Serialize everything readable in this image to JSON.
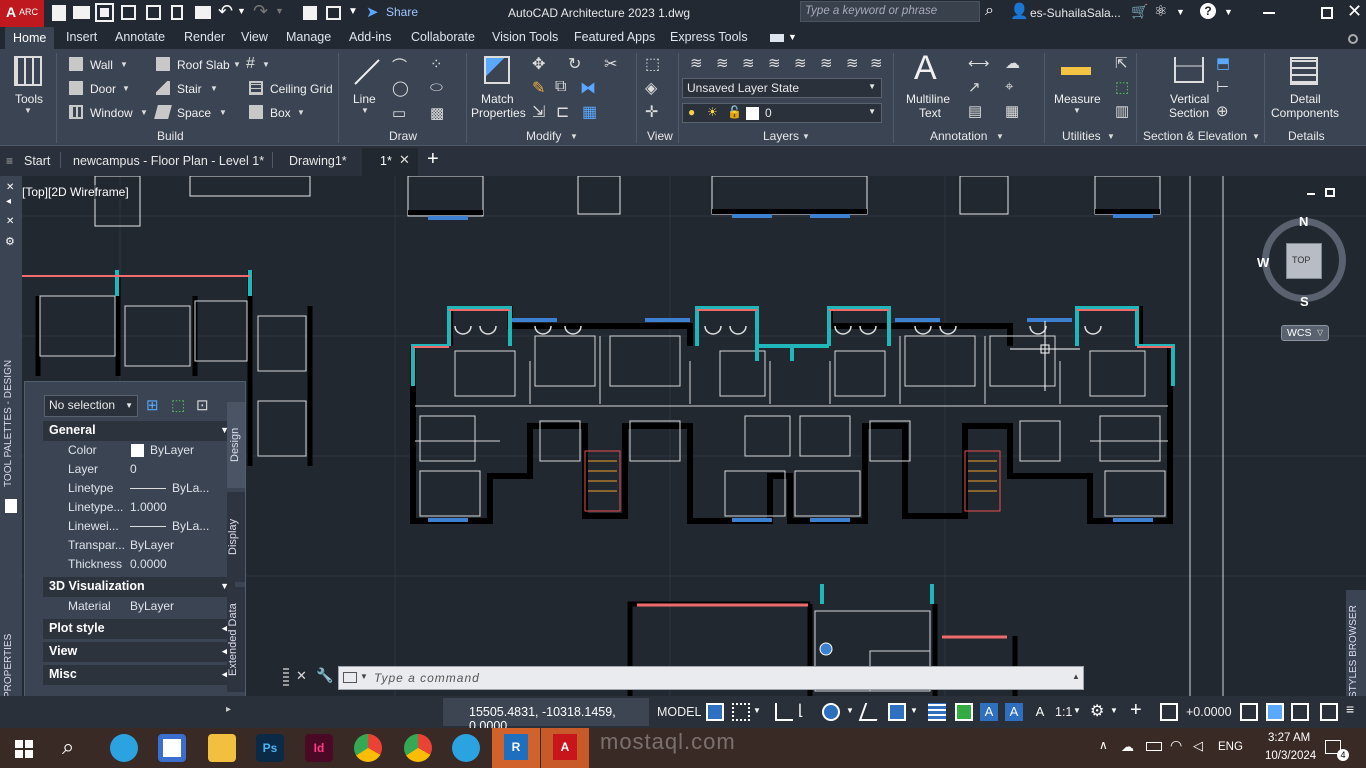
{
  "titlebar": {
    "app_badge": "A",
    "app_badge_sub": "ARC",
    "share_label": "Share",
    "title": "AutoCAD Architecture 2023   1.dwg",
    "search_placeholder": "Type a keyword or phrase",
    "user": "es-SuhailaSala..."
  },
  "menu_tabs": [
    "Home",
    "Insert",
    "Annotate",
    "Render",
    "View",
    "Manage",
    "Add-ins",
    "Collaborate",
    "Vision Tools",
    "Featured Apps",
    "Express Tools"
  ],
  "ribbon": {
    "tools_label": "Tools",
    "build": {
      "wall": "Wall",
      "door": "Door",
      "window": "Window",
      "roof_slab": "Roof Slab",
      "stair": "Stair",
      "space": "Space",
      "ceiling_grid": "Ceiling Grid",
      "box": "Box",
      "panel": "Build"
    },
    "draw": {
      "line": "Line",
      "panel": "Draw"
    },
    "modify": {
      "match_properties_1": "Match",
      "match_properties_2": "Properties",
      "panel": "Modify"
    },
    "view_panel": "View",
    "layers": {
      "layer_state": "Unsaved Layer State",
      "current_layer": "0",
      "panel": "Layers"
    },
    "annotation": {
      "mtext_1": "Multiline",
      "mtext_2": "Text",
      "panel": "Annotation"
    },
    "utilities": {
      "measure": "Measure",
      "panel": "Utilities"
    },
    "section": {
      "vertical_1": "Vertical",
      "vertical_2": "Section",
      "panel": "Section & Elevation"
    },
    "details": {
      "detail_1": "Detail",
      "detail_2": "Components",
      "panel": "Details"
    }
  },
  "doc_tabs": [
    "Start",
    "newcampus - Floor Plan - Level 1*",
    "Drawing1*",
    "1*"
  ],
  "viewport_label": "[Top][2D Wireframe]",
  "viewcube": {
    "n": "N",
    "s": "S",
    "w": "W",
    "top": "TOP",
    "wcs": "WCS"
  },
  "properties": {
    "selection": "No selection",
    "general_header": "General",
    "rows": [
      {
        "label": "Color",
        "value": "ByLayer"
      },
      {
        "label": "Layer",
        "value": "0"
      },
      {
        "label": "Linetype",
        "value": "ByLa..."
      },
      {
        "label": "Linetype...",
        "value": "1.0000"
      },
      {
        "label": "Linewei...",
        "value": "ByLa..."
      },
      {
        "label": "Transpar...",
        "value": "ByLayer"
      },
      {
        "label": "Thickness",
        "value": "0.0000"
      }
    ],
    "viz_header": "3D Visualization",
    "material_label": "Material",
    "material_value": "ByLayer",
    "collapsed": [
      "Plot style",
      "View",
      "Misc"
    ],
    "side_tabs": [
      "Design",
      "Display",
      "Extended Data"
    ],
    "left_labels": [
      "TOOL PALETTES - DESIGN",
      "PROPERTIES"
    ],
    "right_label": "STYLES BROWSER"
  },
  "command_line": {
    "placeholder": "Type a command"
  },
  "statusbar": {
    "coords": "15505.4831, -10318.1459, 0.0000",
    "model": "MODEL",
    "scale": "1:1",
    "elevation": "+0.0000"
  },
  "taskbar": {
    "lang": "ENG",
    "time": "3:27 AM",
    "date": "10/3/2024",
    "notification_count": "4",
    "watermark": "mostaql.com"
  },
  "colors": {
    "ribbon_bg": "#3b4453",
    "canvas_bg": "#212830",
    "accent_cyan": "#19b7b9",
    "wall_red": "#f06b6b"
  }
}
